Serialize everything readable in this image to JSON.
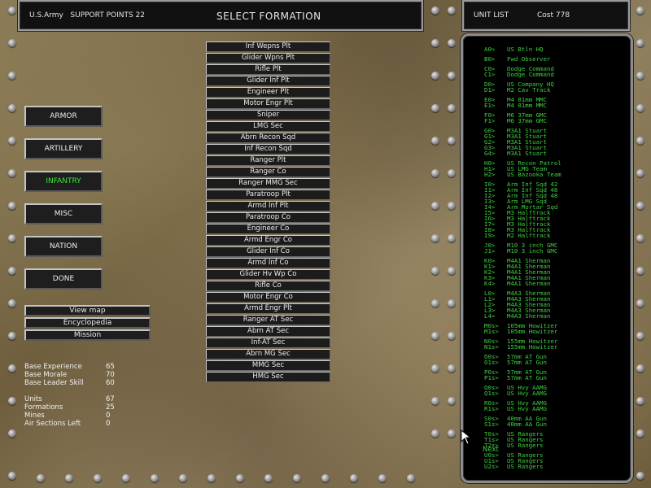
{
  "header": {
    "left": "U.S.Army   SUPPORT POINTS 22",
    "title": "SELECT FORMATION"
  },
  "unit_header": {
    "label": "UNIT LIST",
    "cost": "Cost 778"
  },
  "categories": [
    "ARMOR",
    "ARTILLERY",
    "INFANTRY",
    "MISC",
    "NATION",
    "DONE"
  ],
  "active_category": "INFANTRY",
  "small_buttons": [
    "View map",
    "Encyclopedia",
    "Mission"
  ],
  "stats": {
    "base_experience": {
      "label": "Base Experience",
      "value": "65"
    },
    "base_morale": {
      "label": "Base Morale",
      "value": "70"
    },
    "base_leader_skill": {
      "label": "Base Leader Skill",
      "value": "60"
    },
    "units": {
      "label": "Units",
      "value": "67"
    },
    "formations": {
      "label": "Formations",
      "value": "25"
    },
    "mines": {
      "label": "Mines",
      "value": "0"
    },
    "air_sections": {
      "label": "Air Sections Left",
      "value": "0"
    }
  },
  "formations": [
    "Inf Wepns Plt",
    "Glider Wpns Plt",
    "Rifle Plt",
    "Glider Inf Plt",
    "Engineer Plt",
    "Motor Engr Plt",
    "Sniper",
    "LMG Sec",
    "Abrn Recon Sqd",
    "Inf Recon Sqd",
    "Ranger Plt",
    "Ranger Co",
    "Ranger MMG Sec",
    "Paratroop Plt",
    "Armd Inf Plt",
    "Paratroop Co",
    "Engineer Co",
    "Armd Engr Co",
    "Glider Inf Co",
    "Armd Inf Co",
    "Glider Hv Wp Co",
    "Rifle Co",
    "Motor Engr Co",
    "Armd Engr Plt",
    "Ranger AT Sec",
    "Abrn AT Sec",
    "Inf-AT Sec",
    "Abrn MG Sec",
    "MMG Sec",
    "HMG Sec"
  ],
  "unit_list": [
    {
      "code": "A0>",
      "name": "US Btln HQ"
    },
    {
      "code": "B0>",
      "name": "Fwd Observer"
    },
    {
      "code": "C0>",
      "name": "Dodge Command"
    },
    {
      "code": "C1>",
      "name": "Dodge Command"
    },
    {
      "code": "D0>",
      "name": "US Company HQ"
    },
    {
      "code": "D1>",
      "name": "M2 Cav Track"
    },
    {
      "code": "E0>",
      "name": "M4 81mm MMC"
    },
    {
      "code": "E1>",
      "name": "M4 81mm MMC"
    },
    {
      "code": "F0>",
      "name": "M6 37mm GMC"
    },
    {
      "code": "F1>",
      "name": "M6 37mm GMC"
    },
    {
      "code": "G0>",
      "name": "M3A1 Stuart"
    },
    {
      "code": "G1>",
      "name": "M3A1 Stuart"
    },
    {
      "code": "G2>",
      "name": "M3A1 Stuart"
    },
    {
      "code": "G3>",
      "name": "M3A1 Stuart"
    },
    {
      "code": "G4>",
      "name": "M3A1 Stuart"
    },
    {
      "code": "H0>",
      "name": "US Recon Patrol"
    },
    {
      "code": "H1>",
      "name": "US LMG Team"
    },
    {
      "code": "H2>",
      "name": "US Bazooka Team"
    },
    {
      "code": "I0>",
      "name": "Arm Inf Sqd 42"
    },
    {
      "code": "I1>",
      "name": "Arm Inf Sqd 48"
    },
    {
      "code": "I2>",
      "name": "Arm Inf Sqd 48"
    },
    {
      "code": "I3>",
      "name": "Arm LMG Sqd"
    },
    {
      "code": "I4>",
      "name": "Arm Mortar Sqd"
    },
    {
      "code": "I5>",
      "name": "M3 Halftrack"
    },
    {
      "code": "I6>",
      "name": "M3 Halftrack"
    },
    {
      "code": "I7>",
      "name": "M3 Halftrack"
    },
    {
      "code": "I8>",
      "name": "M3 Halftrack"
    },
    {
      "code": "I9>",
      "name": "M2 Halftrack"
    },
    {
      "code": "J0>",
      "name": "M10 3 inch GMC"
    },
    {
      "code": "J1>",
      "name": "M10 3 inch GMC"
    },
    {
      "code": "K0>",
      "name": "M4A1 Sherman"
    },
    {
      "code": "K1>",
      "name": "M4A1 Sherman"
    },
    {
      "code": "K2>",
      "name": "M4A1 Sherman"
    },
    {
      "code": "K3>",
      "name": "M4A1 Sherman"
    },
    {
      "code": "K4>",
      "name": "M4A1 Sherman"
    },
    {
      "code": "L0>",
      "name": "M4A3 Sherman"
    },
    {
      "code": "L1>",
      "name": "M4A3 Sherman"
    },
    {
      "code": "L2>",
      "name": "M4A3 Sherman"
    },
    {
      "code": "L3>",
      "name": "M4A3 Sherman"
    },
    {
      "code": "L4>",
      "name": "M4A3 Sherman"
    },
    {
      "code": "M0s>",
      "name": "105mm Howitzer"
    },
    {
      "code": "M1s>",
      "name": "105mm Howitzer"
    },
    {
      "code": "N0s>",
      "name": "155mm Howitzer"
    },
    {
      "code": "N1s>",
      "name": "155mm Howitzer"
    },
    {
      "code": "O0s>",
      "name": "57mm AT Gun"
    },
    {
      "code": "O1s>",
      "name": "57mm AT Gun"
    },
    {
      "code": "P0s>",
      "name": "57mm AT Gun"
    },
    {
      "code": "P1s>",
      "name": "57mm AT Gun"
    },
    {
      "code": "Q0s>",
      "name": "US Hvy AAMG"
    },
    {
      "code": "Q1s>",
      "name": "US Hvy AAMG"
    },
    {
      "code": "R0s>",
      "name": "US Hvy AAMG"
    },
    {
      "code": "R1s>",
      "name": "US Hvy AAMG"
    },
    {
      "code": "S0s>",
      "name": "40mm AA Gun"
    },
    {
      "code": "S1s>",
      "name": "40mm AA Gun"
    },
    {
      "code": "T0s>",
      "name": "US Rangers"
    },
    {
      "code": "T1s>",
      "name": "US Rangers"
    },
    {
      "code": "T2s>",
      "name": "US Rangers"
    },
    {
      "code": "U0s>",
      "name": "US Rangers"
    },
    {
      "code": "U1s>",
      "name": "US Rangers"
    },
    {
      "code": "U2s>",
      "name": "US Rangers"
    }
  ],
  "next_label": "Next",
  "colors": {
    "green_text": "#3fcf3f",
    "active_category": "#38e838",
    "panel_bg": "#000000"
  }
}
